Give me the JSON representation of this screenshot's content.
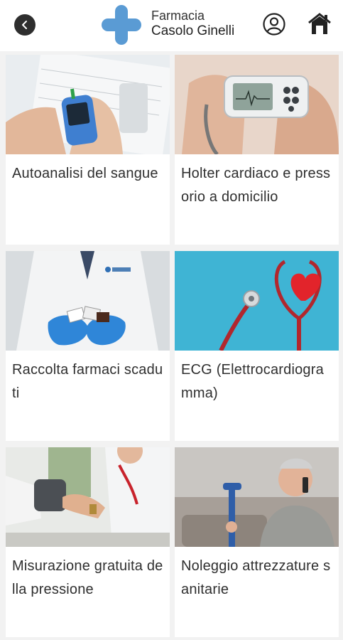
{
  "header": {
    "brand_line1": "Farmacia",
    "brand_line2": "Casolo Ginelli",
    "logo_icon": "medical-cross-icon",
    "back_icon": "chevron-left-icon",
    "user_icon": "user-circle-icon",
    "home_icon": "home-icon",
    "accent_color": "#5a9bd4"
  },
  "services": [
    {
      "title": "Autoanalisi del sangue",
      "image": "glucose-meter-photo"
    },
    {
      "title": "Holter cardiaco e pressorio a domicilio",
      "image": "holter-device-photo"
    },
    {
      "title": "Raccolta farmaci scaduti",
      "image": "pharmacist-hands-medicines-photo"
    },
    {
      "title": "ECG (Elettrocardiogramma)",
      "image": "stethoscope-heart-photo"
    },
    {
      "title": "Misurazione gratuita della pressione",
      "image": "blood-pressure-measurement-photo"
    },
    {
      "title": "Noleggio attrezzature sanitarie",
      "image": "senior-man-crutch-photo"
    }
  ]
}
